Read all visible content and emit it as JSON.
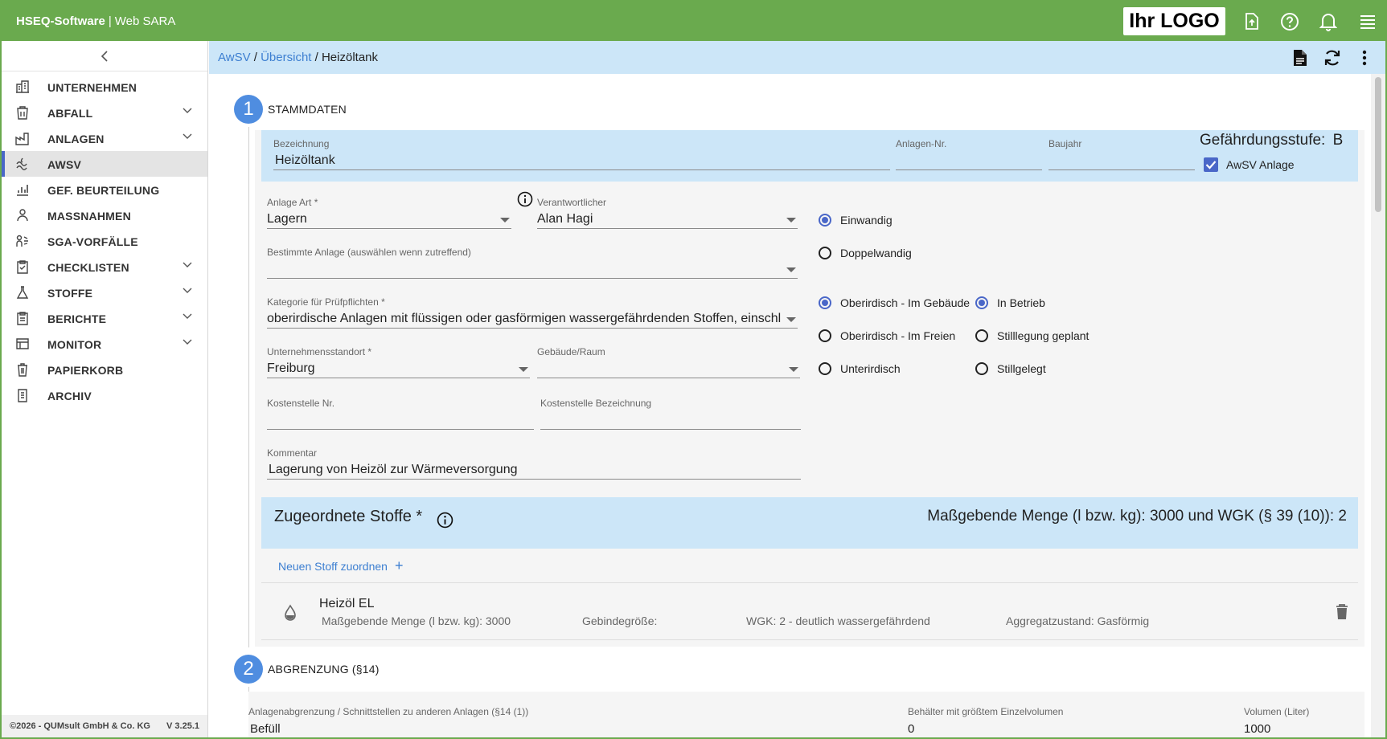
{
  "header": {
    "brand_bold": "HSEQ-Software",
    "brand_sep": "|",
    "brand_app": "Web SARA",
    "logo_text": "Ihr LOGO",
    "icons": [
      "upload-file-icon",
      "help-icon",
      "bell-icon",
      "menu-icon"
    ]
  },
  "sidebar": {
    "items": [
      {
        "label": "UNTERNEHMEN",
        "icon": "building-icon",
        "expandable": false
      },
      {
        "label": "ABFALL",
        "icon": "waste-icon",
        "expandable": true
      },
      {
        "label": "ANLAGEN",
        "icon": "factory-icon",
        "expandable": true
      },
      {
        "label": "AWSV",
        "icon": "water-icon",
        "expandable": false,
        "active": true
      },
      {
        "label": "GEF. BEURTEILUNG",
        "icon": "chart-icon",
        "expandable": false
      },
      {
        "label": "MASSNAHMEN",
        "icon": "measures-icon",
        "expandable": false
      },
      {
        "label": "SGA-VORFÄLLE",
        "icon": "incident-icon",
        "expandable": false
      },
      {
        "label": "CHECKLISTEN",
        "icon": "checklist-icon",
        "expandable": true
      },
      {
        "label": "STOFFE",
        "icon": "flask-icon",
        "expandable": true
      },
      {
        "label": "BERICHTE",
        "icon": "report-icon",
        "expandable": true
      },
      {
        "label": "MONITOR",
        "icon": "monitor-icon",
        "expandable": true
      },
      {
        "label": "PAPIERKORB",
        "icon": "trash-icon",
        "expandable": false
      },
      {
        "label": "ARCHIV",
        "icon": "archive-icon",
        "expandable": false
      }
    ],
    "footer_copyright": "©2026 - QUMsult GmbH & Co. KG",
    "footer_version": "V 3.25.1"
  },
  "breadcrumb": {
    "items": [
      "AwSV",
      "Übersicht"
    ],
    "sep": "/",
    "current": "Heizöltank"
  },
  "section1": {
    "number": "1",
    "title": "STAMMDATEN",
    "bezeichnung_label": "Bezeichnung",
    "bezeichnung_value": "Heizöltank",
    "anlagen_nr_label": "Anlagen-Nr.",
    "anlagen_nr_value": "",
    "baujahr_label": "Baujahr",
    "baujahr_value": "",
    "gefaehrdung_label": "Gefährdungsstufe:",
    "gefaehrdung_value": "B",
    "awsv_checkbox_label": "AwSV Anlage",
    "awsv_checked": true,
    "anlage_art_label": "Anlage Art *",
    "anlage_art_value": "Lagern",
    "verantwortlicher_label": "Verantwortlicher",
    "verantwortlicher_value": "Alan Hagi",
    "bestimmte_label": "Bestimmte Anlage (auswählen wenn zutreffend)",
    "bestimmte_value": "",
    "kategorie_label": "Kategorie für Prüfpflichten *",
    "kategorie_value": "oberirdische Anlagen mit flüssigen oder gasförmigen wassergefährdenden Stoffen, einschließlich",
    "standort_label": "Unternehmensstandort *",
    "standort_value": "Freiburg",
    "gebaeude_label": "Gebäude/Raum",
    "gebaeude_value": "",
    "kst_nr_label": "Kostenstelle Nr.",
    "kst_nr_value": "",
    "kst_bez_label": "Kostenstelle Bezeichnung",
    "kst_bez_value": "",
    "kommentar_label": "Kommentar",
    "kommentar_value": "Lagerung von Heizöl zur Wärmeversorgung",
    "wand_options": [
      {
        "label": "Einwandig",
        "selected": true
      },
      {
        "label": "Doppelwandig",
        "selected": false
      }
    ],
    "lage_options": [
      {
        "label": "Oberirdisch - Im Gebäude",
        "selected": true
      },
      {
        "label": "Oberirdisch - Im Freien",
        "selected": false
      },
      {
        "label": "Unterirdisch",
        "selected": false
      }
    ],
    "status_options": [
      {
        "label": "In Betrieb",
        "selected": true
      },
      {
        "label": "Stilllegung geplant",
        "selected": false
      },
      {
        "label": "Stillgelegt",
        "selected": false
      }
    ]
  },
  "stoffe": {
    "title": "Zugeordnete Stoffe *",
    "summary": "Maßgebende Menge (l bzw. kg): 3000 und WGK (§ 39 (10)): 2",
    "add_link": "Neuen Stoff zuordnen",
    "add_icon": "+",
    "items": [
      {
        "name": "Heizöl EL",
        "menge": "Maßgebende Menge (l bzw. kg): 3000",
        "gebinde": "Gebindegröße:",
        "wgk": "WGK: 2 - deutlich wassergefährdend",
        "aggregat": "Aggregatzustand: Gasförmig"
      }
    ]
  },
  "section2": {
    "number": "2",
    "title": "ABGRENZUNG (§14)",
    "col1_label": "Anlagenabgrenzung / Schnittstellen zu anderen Anlagen (§14 (1))",
    "col2_label": "Behälter mit größtem Einzelvolumen",
    "col3_label": "Volumen (Liter)",
    "col1_value_partial": "Befüll",
    "col2_value_partial": "0",
    "col3_value_partial": "1000"
  },
  "colors": {
    "header_green": "#6aaa4e",
    "light_blue": "#cce6f8",
    "accent_blue": "#4a67c8",
    "step_blue": "#4f8de0",
    "link_blue": "#3d7fd1"
  }
}
